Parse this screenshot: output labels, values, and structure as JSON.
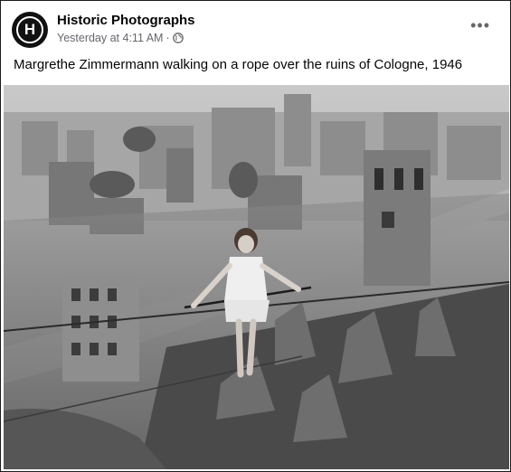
{
  "post": {
    "page_name": "Historic Photographs",
    "avatar_letter": "H",
    "timestamp": "Yesterday at 4:11 AM",
    "separator": "·",
    "audience_icon": "globe-icon",
    "more_icon": "more-options-icon",
    "more_glyph": "•••",
    "caption": "Margrethe Zimmermann walking on a rope over the ruins of Cologne, 1946"
  }
}
